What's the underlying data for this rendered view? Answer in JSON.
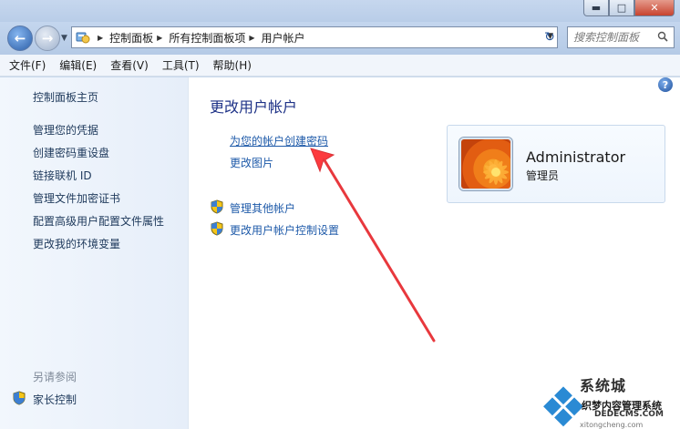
{
  "window": {
    "caption_buttons": [
      "minimize",
      "maximize",
      "close"
    ]
  },
  "navigation": {
    "breadcrumbs": [
      "控制面板",
      "所有控制面板项",
      "用户帐户"
    ],
    "search_placeholder": "搜索控制面板"
  },
  "menu": [
    "文件(F)",
    "编辑(E)",
    "查看(V)",
    "工具(T)",
    "帮助(H)"
  ],
  "sidebar": {
    "links": [
      "控制面板主页",
      "管理您的凭据",
      "创建密码重设盘",
      "链接联机 ID",
      "管理文件加密证书",
      "配置高级用户配置文件属性",
      "更改我的环境变量"
    ],
    "see_also_label": "另请参阅",
    "see_also_items": [
      "家长控制"
    ]
  },
  "main": {
    "title": "更改用户帐户",
    "tasks": [
      "为您的帐户创建密码",
      "更改图片"
    ],
    "shield_tasks": [
      "管理其他帐户",
      "更改用户帐户控制设置"
    ],
    "help_label": "?"
  },
  "user": {
    "name": "Administrator",
    "role": "管理员"
  },
  "annotation": {
    "arrow_color": "#e8383d"
  },
  "watermark": {
    "brand": "系统城",
    "line1": "织梦内容管理系统",
    "line2": "DEDECMS.COM",
    "line3": "xitongcheng.com"
  },
  "icons": {
    "shield": "uac-shield-icon",
    "users": "user-accounts-icon"
  },
  "colors": {
    "link": "#1e5aa9",
    "title": "#1e3287",
    "sidebar_link": "#1e395b"
  }
}
